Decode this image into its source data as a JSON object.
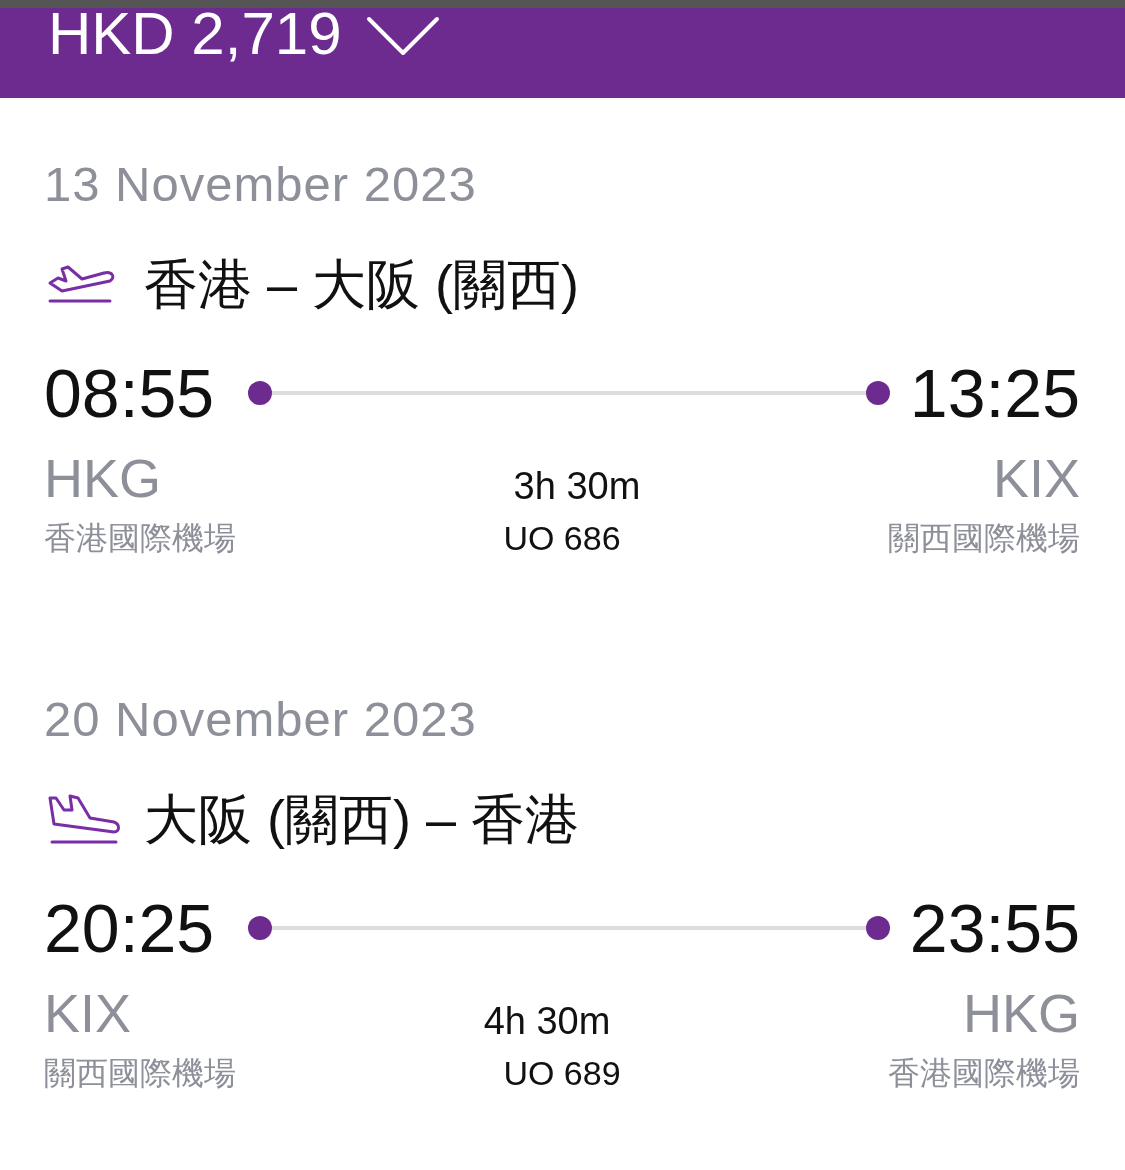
{
  "price_bar": {
    "price": "HKD 2,719",
    "expanded": false
  },
  "legs": [
    {
      "date": "13 November 2023",
      "kind": "departure",
      "route": "香港 – 大阪 (關西)",
      "depart_time": "08:55",
      "arrive_time": "13:25",
      "origin_code": "HKG",
      "destination_code": "KIX",
      "duration": "3h 30m",
      "origin_airport": "香港國際機場",
      "flight_number": "UO 686",
      "destination_airport": "關西國際機場"
    },
    {
      "date": "20 November 2023",
      "kind": "arrival",
      "route": "大阪 (關西) – 香港",
      "depart_time": "20:25",
      "arrive_time": "23:55",
      "origin_code": "KIX",
      "destination_code": "HKG",
      "duration": "4h 30m",
      "origin_airport": "關西國際機場",
      "flight_number": "UO 689",
      "destination_airport": "香港國際機場"
    }
  ]
}
